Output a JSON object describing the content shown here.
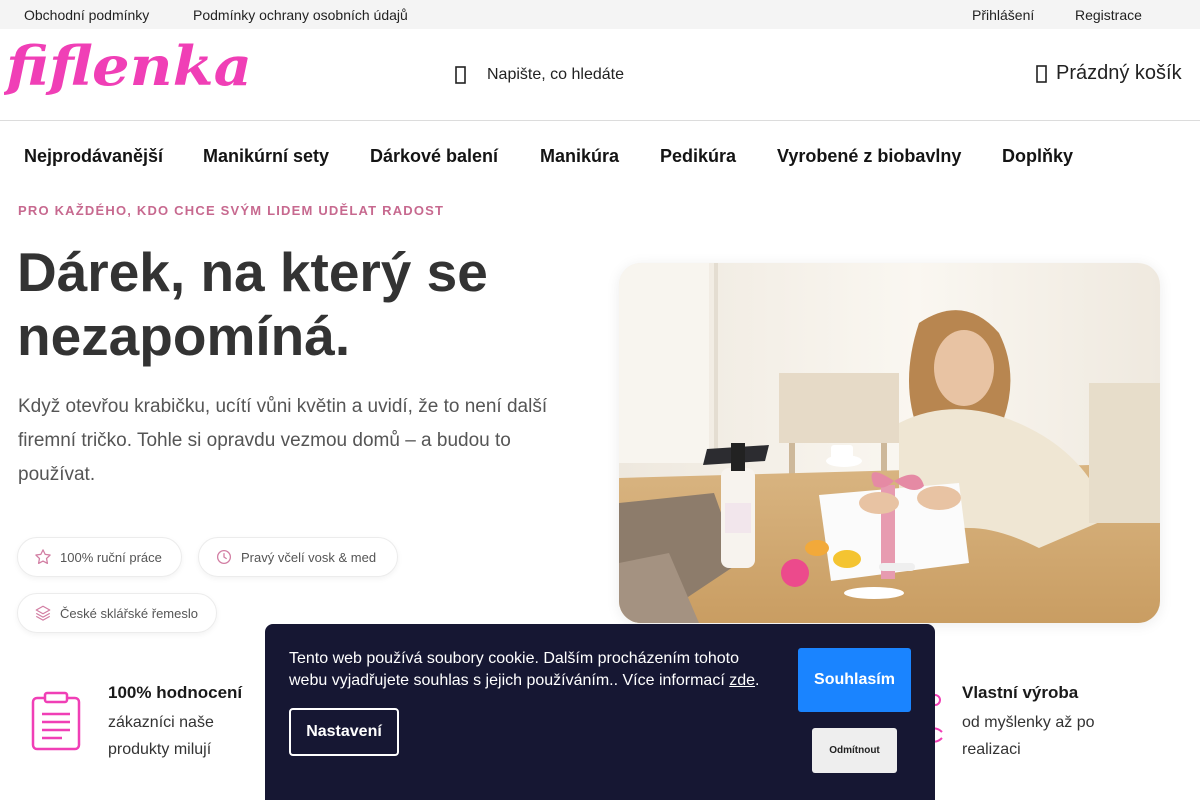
{
  "topbar": {
    "left_links": [
      "Obchodní podmínky",
      "Podmínky ochrany osobních údajů"
    ],
    "right_links": [
      "Přihlášení",
      "Registrace"
    ]
  },
  "header": {
    "logo_text": "fiflenka",
    "search_placeholder": "Napište, co hledáte",
    "cart_label": "Prázdný košík",
    "icons": {
      "search": "search-icon",
      "cart": "cart-icon"
    }
  },
  "nav": {
    "items": [
      "Nejprodávanější",
      "Manikúrní sety",
      "Dárkové balení",
      "Manikúra",
      "Pedikúra",
      "Vyrobené z biobavlny",
      "Doplňky"
    ]
  },
  "hero": {
    "kicker": "PRO KAŽDÉHO, KDO CHCE SVÝM LIDEM UDĚLAT RADOST",
    "title": "Dárek, na který se nezapomíná.",
    "text": "Když otevřou krabičku, ucítí vůni květin a uvidí, že to není další firemní tričko. Tohle si opravdu vezmou domů – a budou to používat.",
    "pills": [
      {
        "label": "100% ruční práce",
        "icon": "star-icon"
      },
      {
        "label": "Pravý včelí vosk & med",
        "icon": "clock-icon"
      },
      {
        "label": "České sklářské řemeslo",
        "icon": "layers-icon"
      }
    ],
    "image_alt": "woman-wrapping-gift-photo"
  },
  "features": [
    {
      "title": "100% hodnocení",
      "text": "zákazníci naše produkty milují",
      "icon": "clipboard-icon"
    },
    {
      "title": "Vlastní výroba",
      "text": "od myšlenky až po realizaci",
      "icon": "production-icon"
    }
  ],
  "cookie": {
    "text_main": "Tento web používá soubory cookie. Dalším procházením tohoto webu vyjadřujete souhlas s jejich používáním.. Více informací ",
    "link": "zde",
    "text_end": ".",
    "accept": "Souhlasím",
    "settings": "Nastavení",
    "reject": "Odmítnout"
  },
  "colors": {
    "brand_pink": "#f03fb6",
    "accent_blue": "#1a84ff",
    "cookie_bg": "#161733",
    "kicker_pink": "#c7698f"
  }
}
